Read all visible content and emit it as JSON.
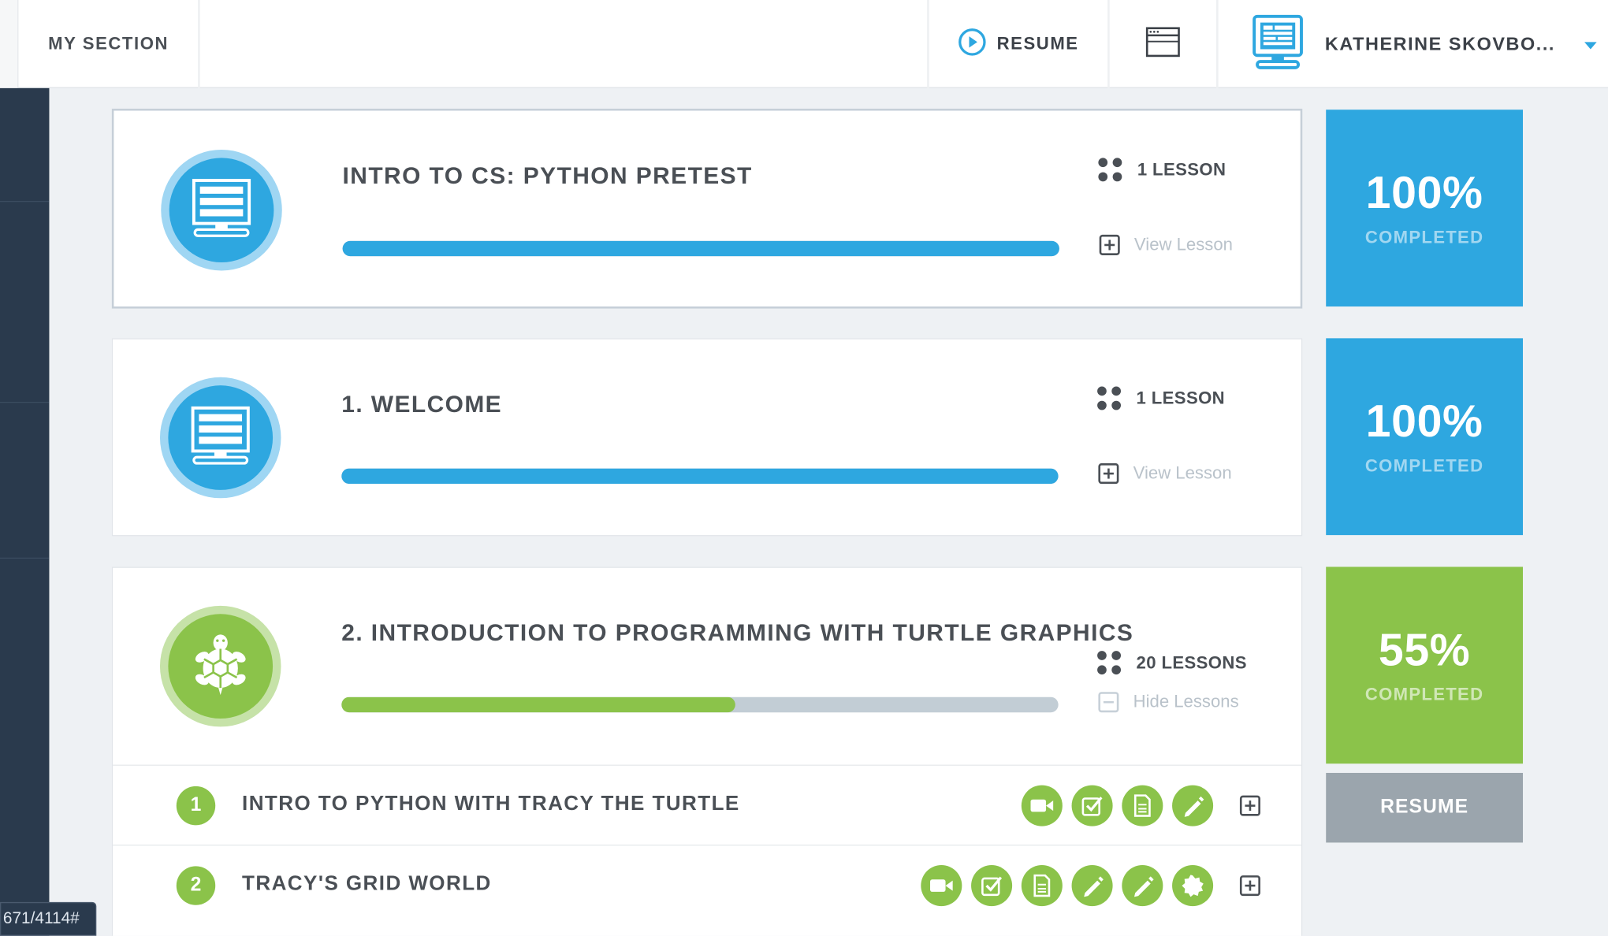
{
  "topbar": {
    "section_label": "MY SECTION",
    "resume_label": "RESUME",
    "user_name": "KATHERINE SKOVBO..."
  },
  "modules": [
    {
      "title": "INTRO TO CS: PYTHON PRETEST",
      "lessons_label": "1 LESSON",
      "toggle_label": "View Lesson",
      "progress": 100,
      "percent_label": "100%",
      "completed_label": "COMPLETED",
      "color": "#2ea7e0",
      "icon": "computer-icon"
    },
    {
      "title": "1. WELCOME",
      "lessons_label": "1 LESSON",
      "toggle_label": "View Lesson",
      "progress": 100,
      "percent_label": "100%",
      "completed_label": "COMPLETED",
      "color": "#2ea7e0",
      "icon": "computer-icon"
    },
    {
      "title": "2. INTRODUCTION TO PROGRAMMING WITH TURTLE GRAPHICS",
      "lessons_label": "20 LESSONS",
      "toggle_label": "Hide Lessons",
      "progress": 55,
      "percent_label": "55%",
      "completed_label": "COMPLETED",
      "resume_label": "RESUME",
      "color": "#8bc34a",
      "icon": "turtle-icon",
      "lessons": [
        {
          "number": "1",
          "title": "INTRO TO PYTHON WITH TRACY THE TURTLE",
          "activities": [
            "video-icon",
            "checkbox-icon",
            "document-icon",
            "pencil-icon"
          ]
        },
        {
          "number": "2",
          "title": "TRACY'S GRID WORLD",
          "activities": [
            "video-icon",
            "checkbox-icon",
            "document-icon",
            "pencil-icon",
            "pencil-icon",
            "badge-icon"
          ]
        }
      ]
    }
  ],
  "status_bar_url": "671/4114#"
}
